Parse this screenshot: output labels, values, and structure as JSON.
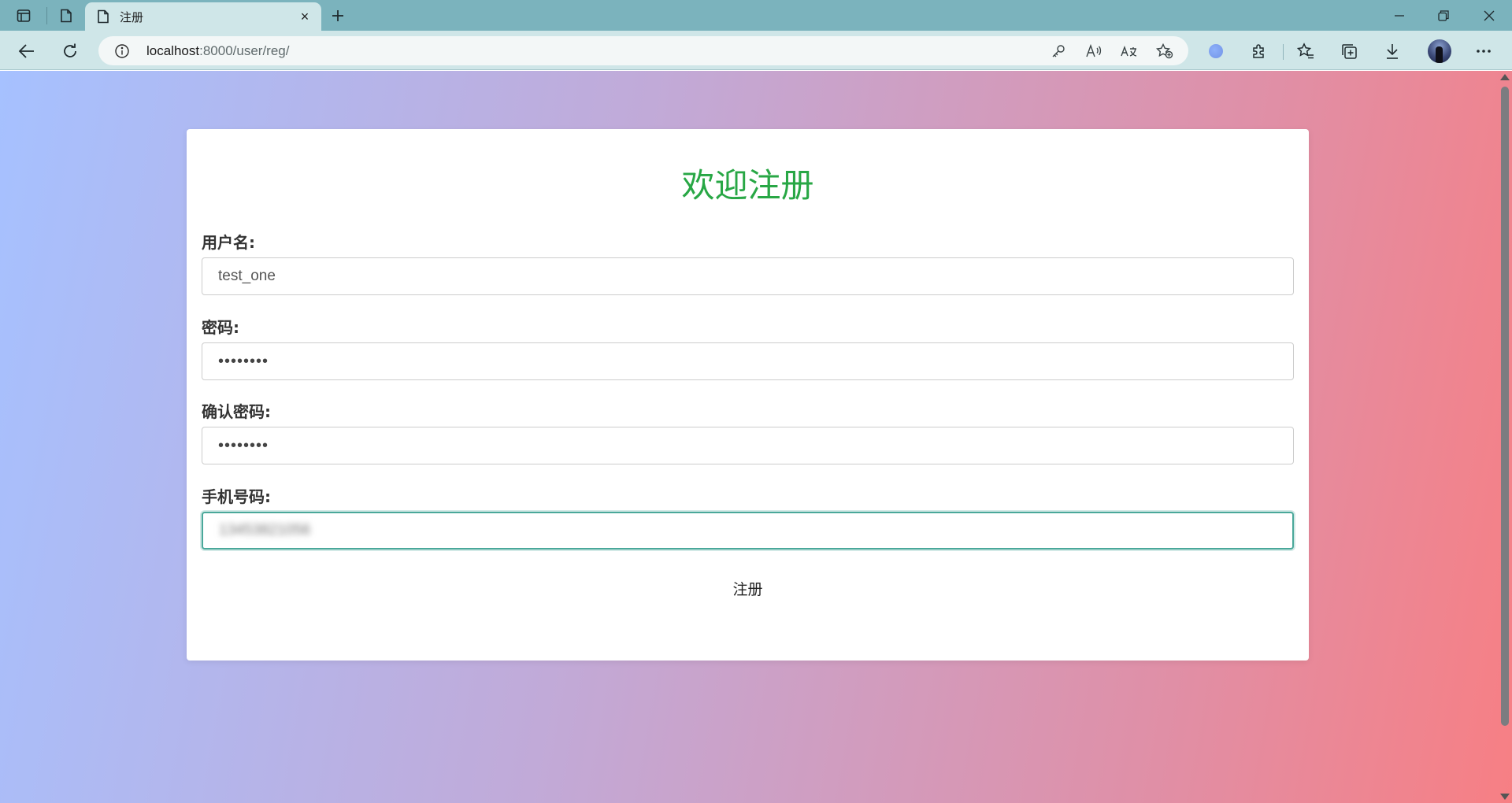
{
  "browser": {
    "tab_title": "注册",
    "url_host": "localhost",
    "url_rest": ":8000/user/reg/",
    "tab_close": "×"
  },
  "page": {
    "title": "欢迎注册",
    "fields": [
      {
        "label": "用户名:",
        "value": "test_one",
        "type": "text"
      },
      {
        "label": "密码:",
        "value": "••••••••",
        "type": "password"
      },
      {
        "label": "确认密码:",
        "value": "••••••••",
        "type": "password"
      },
      {
        "label": "手机号码:",
        "value": "13453821056",
        "type": "tel",
        "focused": true,
        "blurred": true
      }
    ],
    "submit_label": "注册"
  },
  "colors": {
    "title": "#28a745",
    "gradient_start": "#a6c1ff",
    "gradient_end": "#f77f84"
  }
}
